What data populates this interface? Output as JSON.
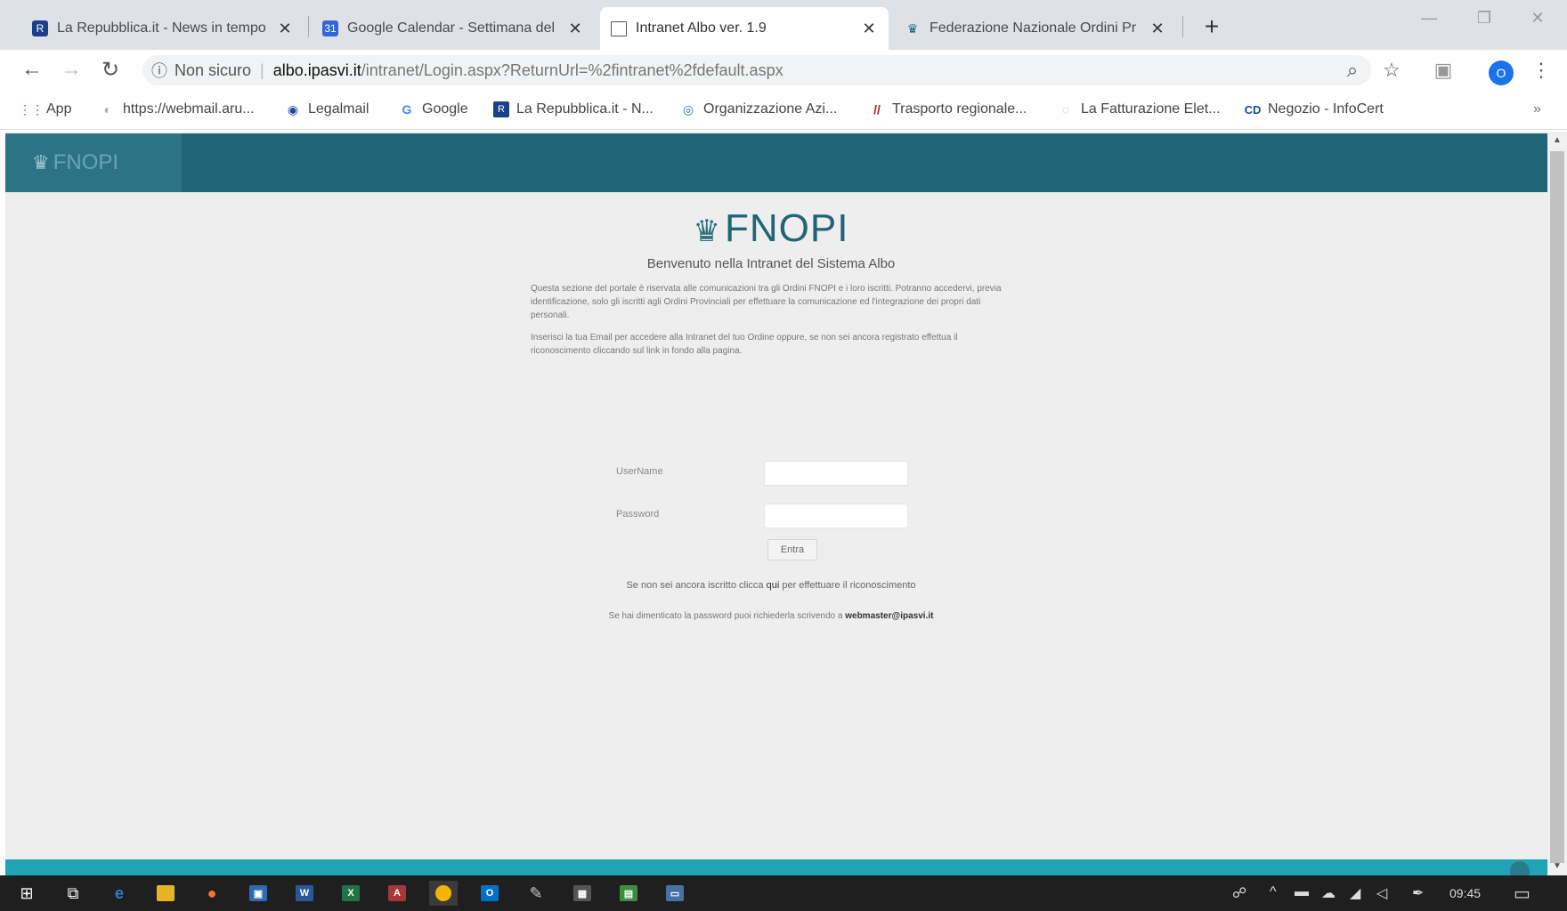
{
  "tabs": [
    {
      "title": "La Repubblica.it - News in tempo",
      "favicon": "repubblica-icon",
      "active": false
    },
    {
      "title": "Google Calendar - Settimana del",
      "favicon": "calendar-icon",
      "active": false
    },
    {
      "title": "Intranet Albo ver. 1.9",
      "favicon": "page-icon",
      "active": true
    },
    {
      "title": "Federazione Nazionale Ordini Pr",
      "favicon": "fnopi-icon",
      "active": false
    }
  ],
  "address": {
    "security_text": "Non sicuro",
    "domain": "albo.ipasvi.it",
    "path": "/intranet/Login.aspx?ReturnUrl=%2fintranet%2fdefault.aspx"
  },
  "bookmarks": [
    {
      "label": "App",
      "icon": "apps-grid-icon"
    },
    {
      "label": "https://webmail.aru...",
      "icon": "webmail-icon"
    },
    {
      "label": "Legalmail",
      "icon": "legalmail-icon"
    },
    {
      "label": "Google",
      "icon": "google-icon"
    },
    {
      "label": "La Repubblica.it - N...",
      "icon": "repubblica-icon"
    },
    {
      "label": "Organizzazione Azi...",
      "icon": "organization-icon"
    },
    {
      "label": "Trasporto regionale...",
      "icon": "train-icon"
    },
    {
      "label": "La Fatturazione Elet...",
      "icon": "invoice-icon"
    },
    {
      "label": "Negozio - InfoCert",
      "icon": "infocert-icon"
    }
  ],
  "profile_initial": "O",
  "header": {
    "logo_text": "FNOPI"
  },
  "login": {
    "brand": "FNOPI",
    "welcome": "Benvenuto nella Intranet del Sistema Albo",
    "description_1": "Questa sezione del portale è riservata alle comunicazioni tra gli Ordini FNOPI e i loro iscritti. Potranno accedervi, previa identificazione, solo gli iscritti agli Ordini Provinciali per effettuare la comunicazione ed l'integrazione dei propri dati personali.",
    "description_2": "Inserisci la tua Email per accedere alla Intranet del tuo Ordine oppure, se non sei ancora registrato effettua il riconoscimento cliccando sul link in fondo alla pagina.",
    "username_label": "UserName",
    "password_label": "Password",
    "submit_label": "Entra",
    "register_prefix": "Se non sei ancora iscritto clicca ",
    "register_link": "qui",
    "register_suffix": " per effettuare il riconoscimento",
    "reset_prefix": "Se hai dimenticato la password puoi richiederla scrivendo a ",
    "reset_email": "webmaster@ipasvi.it"
  },
  "taskbar": {
    "clock": "09:45"
  },
  "colors": {
    "header": "#1f6576",
    "header_logo_bg": "#2d7386",
    "page_bg": "#eeeeee",
    "footer": "#1fa3b5",
    "brand": "#1f6576"
  }
}
